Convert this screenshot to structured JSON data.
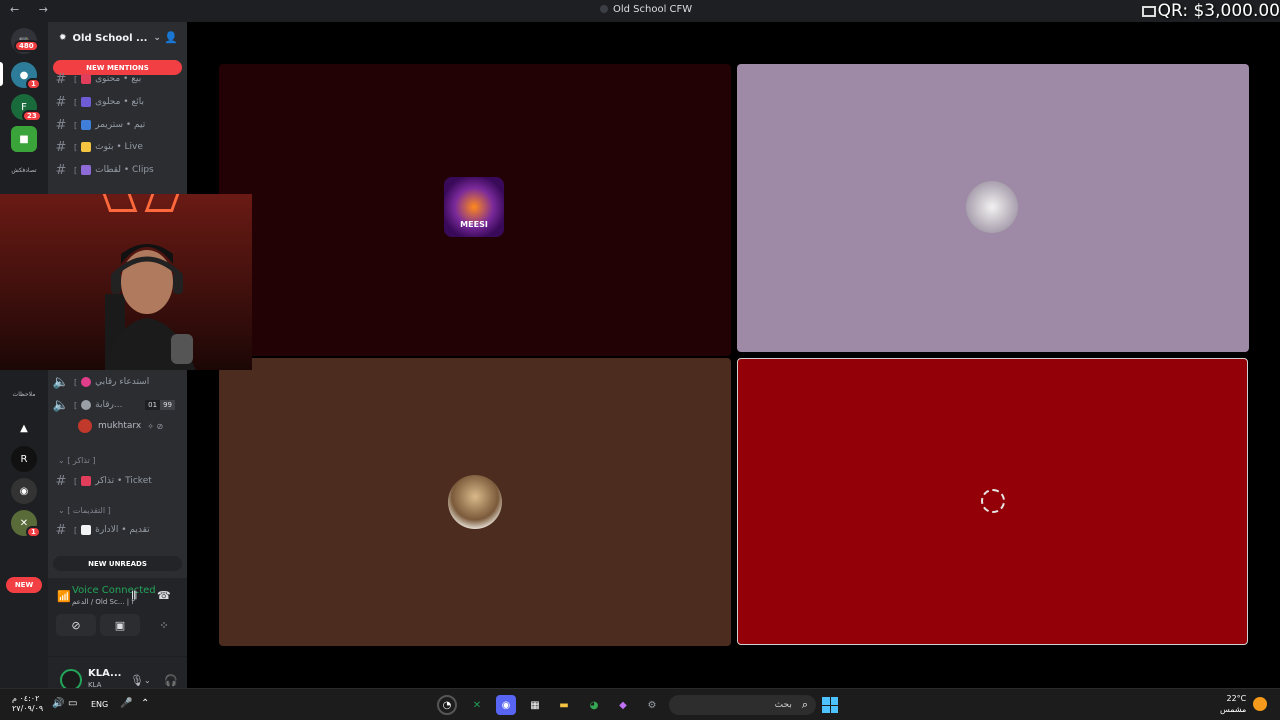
{
  "titlebar": {
    "window_title": "Old School CFW",
    "donation_text": "QR: $3,000.00"
  },
  "rail": {
    "home_badge": "480",
    "servers": [
      {
        "badge": "1",
        "color": "#2d7d9a"
      },
      {
        "badge": "23",
        "color": "#1a6b3c"
      },
      {
        "badge": "",
        "color": "#3aa33a"
      }
    ],
    "label_1": "تصادفكش",
    "label_2": "ملاحظات",
    "lower_badge": "1",
    "new_label": "NEW"
  },
  "sidebar": {
    "server_name": "Old School ...",
    "new_mentions": "NEW MENTIONS",
    "channels_top": [
      {
        "label": "بيع • محتوى",
        "emo_color": "#e03e5a"
      },
      {
        "label": "بائع • محلوى",
        "emo_color": "#6e5bd6"
      },
      {
        "label": "تيم • ستريمر",
        "emo_color": "#3f7fd9"
      },
      {
        "label": "بثوث • Live",
        "emo_color": "#f5c542"
      },
      {
        "label": "لقطات • Clips",
        "emo_color": "#8e6bd6"
      }
    ],
    "voice_channels": [
      {
        "label": "استدعاء رقابي",
        "emo_color": "#e03e8a"
      },
      {
        "label": "رقابة...",
        "emo_color": "#9aa0a6"
      }
    ],
    "voice_count_a": "01",
    "voice_count_b": "99",
    "voice_user": "mukhtarx",
    "category_tickets": "[ تذاكر ]",
    "ticket_channel": "تذاكر • Ticket",
    "category_apply": "[ التقديمات ]",
    "apply_channel": "تقديم • الادارة",
    "new_unreads": "NEW UNREADS"
  },
  "voice_panel": {
    "title": "Voice Connected",
    "subtitle": "الدعم / Old Sc... | ۲"
  },
  "user_panel": {
    "name": "KLA...",
    "status": "KLA"
  },
  "stage": {
    "tiles": [
      {
        "bg": "#220204",
        "avatar_color": "#5a1a8a",
        "avatar_label": "MEESI"
      },
      {
        "bg": "#9e89a6",
        "avatar_color": "#c9c3cc",
        "avatar_label": ""
      },
      {
        "bg": "#4c2c1e",
        "avatar_color": "#d9c7a8",
        "avatar_label": ""
      },
      {
        "bg": "#930007",
        "avatar_color": "#930007",
        "avatar_label": ""
      }
    ]
  },
  "taskbar": {
    "time": "٠٤:٠٢ م",
    "date": "٢٧/٠٩/٠٩",
    "language": "ENG",
    "search_placeholder": "بحث",
    "temperature": "22°C",
    "weather": "مشمس"
  }
}
